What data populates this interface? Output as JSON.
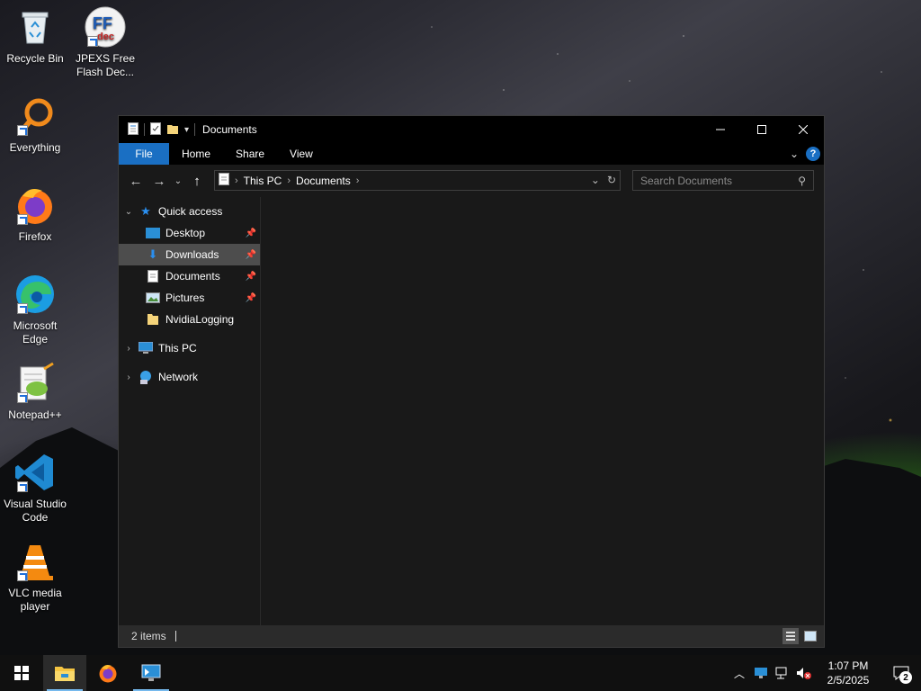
{
  "desktop": {
    "icons": [
      {
        "label": "Recycle Bin"
      },
      {
        "label": "JPEXS Free Flash Dec..."
      },
      {
        "label": "Everything"
      },
      {
        "label": "Firefox"
      },
      {
        "label": "Microsoft Edge"
      },
      {
        "label": "Notepad++"
      },
      {
        "label": "Visual Studio Code"
      },
      {
        "label": "VLC media player"
      }
    ]
  },
  "window": {
    "title": "Documents",
    "ribbon": {
      "file": "File",
      "home": "Home",
      "share": "Share",
      "view": "View",
      "help": "?"
    },
    "address": {
      "this_pc": "This PC",
      "documents": "Documents"
    },
    "search": {
      "placeholder": "Search Documents"
    },
    "nav": {
      "quick_access": "Quick access",
      "items": [
        {
          "label": "Desktop"
        },
        {
          "label": "Downloads"
        },
        {
          "label": "Documents"
        },
        {
          "label": "Pictures"
        },
        {
          "label": "NvidiaLogging"
        }
      ],
      "this_pc": "This PC",
      "network": "Network"
    },
    "status": {
      "items": "2 items"
    }
  },
  "taskbar": {
    "clock": {
      "time": "1:07 PM",
      "date": "2/5/2025"
    },
    "notifications": "2"
  },
  "colors": {
    "accent": "#1a6fc3",
    "selected": "#4d4d4d",
    "window_bg": "#191919"
  }
}
